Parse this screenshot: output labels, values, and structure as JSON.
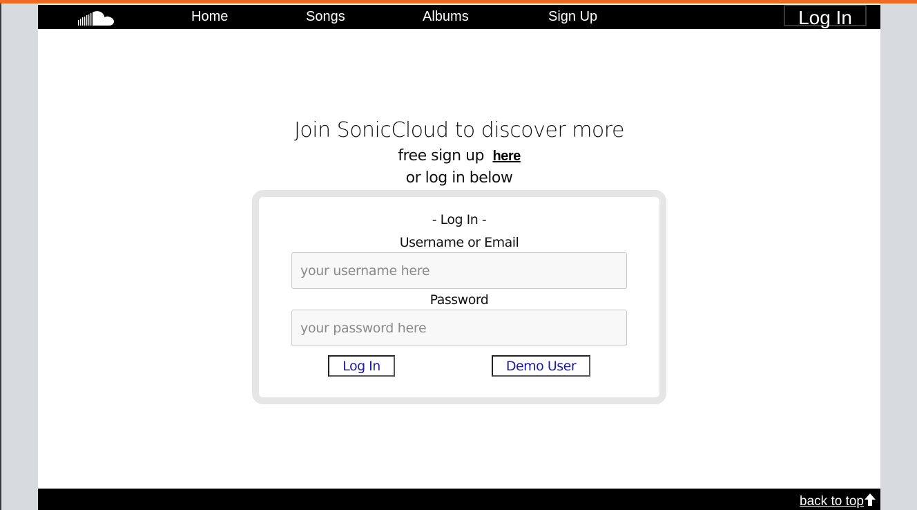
{
  "colors": {
    "accent": "#f26a21",
    "navbar_bg": "#000000",
    "page_bg": "#d7dadf",
    "link_blue": "#1a1aa8"
  },
  "nav": {
    "logo_icon": "soundcloud-cloud-icon",
    "links": [
      "Home",
      "Songs",
      "Albums",
      "Sign Up"
    ],
    "login_label": "Log In"
  },
  "hero": {
    "title": "Join SonicCloud to discover more",
    "signup_prefix": "free sign up",
    "signup_link": "here",
    "login_hint": "or log in below"
  },
  "login_form": {
    "title": "- Log In -",
    "username_label": "Username or Email",
    "username_placeholder": "your username here",
    "username_value": "",
    "password_label": "Password",
    "password_placeholder": "your password here",
    "password_value": "",
    "submit_label": "Log In",
    "demo_label": "Demo User"
  },
  "footer": {
    "back_to_top_label": "back to top",
    "back_to_top_icon": "arrow-up-icon"
  }
}
